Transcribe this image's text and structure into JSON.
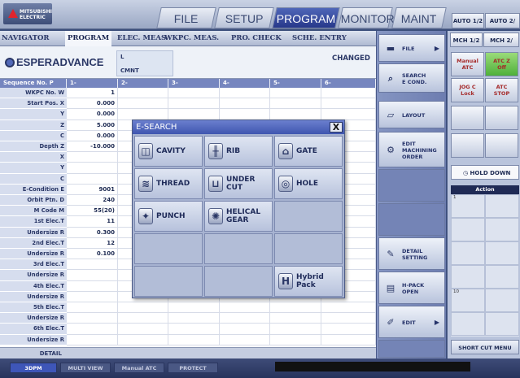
{
  "brand": {
    "line1": "MITSUBISHI",
    "line2": "ELECTRIC"
  },
  "main_tabs": [
    {
      "label": "FILE",
      "active": false
    },
    {
      "label": "SETUP",
      "active": false
    },
    {
      "label": "PROGRAM",
      "active": true
    },
    {
      "label": "MONITOR",
      "active": false
    },
    {
      "label": "MAINT",
      "active": false
    }
  ],
  "right_tabs": [
    "AUTO 1/2",
    "AUTO 2/"
  ],
  "sub_tabs": [
    {
      "label": "NAVIGATOR",
      "active": false
    },
    {
      "label": "PROGRAM",
      "active": true
    },
    {
      "label": "ELEC. MEAS.",
      "active": false
    },
    {
      "label": "WKPC. MEAS.",
      "active": false
    },
    {
      "label": "PRO. CHECK",
      "active": false
    },
    {
      "label": "SCHE. ENTRY",
      "active": false
    }
  ],
  "app_name": "ESPERADVANCE",
  "l_cell": {
    "line1": "L",
    "line2": "CMNT"
  },
  "status": "CHANGED",
  "grid": {
    "columns": [
      "Sequence No. P",
      "1-",
      "2-",
      "3-",
      "4-",
      "5-",
      "6-"
    ],
    "rows": [
      {
        "label": "WKPC No. W",
        "value": "1"
      },
      {
        "label": "Start Pos. X",
        "value": "0.000"
      },
      {
        "label": "Y",
        "value": "0.000"
      },
      {
        "label": "Z",
        "value": "5.000"
      },
      {
        "label": "C",
        "value": "0.000"
      },
      {
        "label": "Depth  Z",
        "value": "-10.000"
      },
      {
        "label": "X",
        "value": ""
      },
      {
        "label": "Y",
        "value": ""
      },
      {
        "label": "C",
        "value": ""
      },
      {
        "label": "E-Condition E",
        "value": "9001"
      },
      {
        "label": "Orbit Ptn. D",
        "value": "240"
      },
      {
        "label": "M Code  M",
        "value": "55(20)"
      },
      {
        "label": "1st Elec.T",
        "value": "11"
      },
      {
        "label": "Undersize R",
        "value": "0.300"
      },
      {
        "label": "2nd Elec.T",
        "value": "12"
      },
      {
        "label": "Undersize R",
        "value": "0.100"
      },
      {
        "label": "3rd Elec.T",
        "value": ""
      },
      {
        "label": "Undersize R",
        "value": ""
      },
      {
        "label": "4th Elec.T",
        "value": ""
      },
      {
        "label": "Undersize R",
        "value": ""
      },
      {
        "label": "5th Elec.T",
        "value": ""
      },
      {
        "label": "Undersize R",
        "value": ""
      },
      {
        "label": "6th Elec.T",
        "value": ""
      },
      {
        "label": "Undersize R",
        "value": ""
      }
    ],
    "detail_label": "DETAIL"
  },
  "dialog": {
    "title": "E-SEARCH",
    "close": "X",
    "buttons": [
      {
        "label": "CAVITY",
        "icon": "cavity-icon"
      },
      {
        "label": "RIB",
        "icon": "rib-icon"
      },
      {
        "label": "GATE",
        "icon": "gate-icon"
      },
      {
        "label": "THREAD",
        "icon": "thread-icon"
      },
      {
        "label": "UNDER\nCUT",
        "icon": "undercut-icon"
      },
      {
        "label": "HOLE",
        "icon": "hole-icon"
      },
      {
        "label": "PUNCH",
        "icon": "punch-icon"
      },
      {
        "label": "HELICAL\nGEAR",
        "icon": "helical-gear-icon"
      },
      {
        "label": "Hybrid\nPack",
        "icon": "hybrid-pack-icon"
      }
    ]
  },
  "side_menu": [
    {
      "label": "FILE",
      "icon": "folder-icon",
      "arrow": true
    },
    {
      "label": "SEARCH\nE COND.",
      "icon": "search-econd-icon",
      "arrow": false
    },
    {
      "label": "LAYOUT",
      "icon": "layout-icon",
      "arrow": false
    },
    {
      "label": "EDIT\nMACHINING\nORDER",
      "icon": "edit-order-icon",
      "arrow": false
    },
    {
      "label": "DETAIL\nSETTING",
      "icon": "detail-setting-icon",
      "arrow": false
    },
    {
      "label": "H-PACK\nOPEN",
      "icon": "hpack-icon",
      "arrow": false
    },
    {
      "label": "EDIT",
      "icon": "edit-icon",
      "arrow": true
    }
  ],
  "far_right": {
    "tabs": [
      "MCH 1/2",
      "MCH 2/"
    ],
    "pads": [
      {
        "line1": "Manual",
        "line2": "ATC",
        "green": false
      },
      {
        "line1": "ATC Z",
        "line2": "Off",
        "green": true
      },
      {
        "line1": "JOG C",
        "line2": "Lock",
        "green": false
      },
      {
        "line1": "ATC",
        "line2": "STOP",
        "green": false
      }
    ],
    "hold": "HOLD DOWN",
    "action": "Action",
    "action_numbers": [
      "1",
      "",
      "",
      "",
      "",
      "",
      "",
      "",
      "10",
      "",
      "",
      ""
    ],
    "shortcut": "SHORT CUT MENU"
  },
  "bottom_buttons": [
    {
      "label": "3DPM",
      "active": true
    },
    {
      "label": "MULTI VIEW",
      "active": false
    },
    {
      "label": "Manual ATC",
      "active": false
    },
    {
      "label": "PROTECT",
      "active": false
    }
  ],
  "colors": {
    "accent": "#3f56b0",
    "panel": "#a7b3d1",
    "header": "#7686bf"
  }
}
